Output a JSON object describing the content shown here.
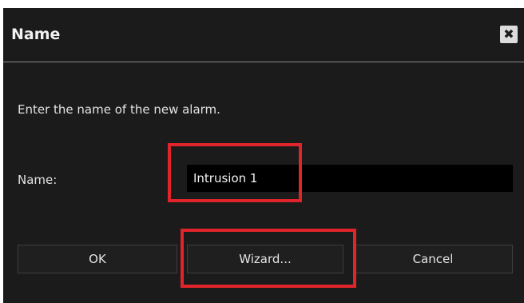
{
  "dialog": {
    "title": "Name",
    "close_symbol": "✖",
    "close_icon": "close-icon",
    "instruction": "Enter the name of the new alarm.",
    "name_label": "Name:",
    "name_value": "Intrusion 1"
  },
  "buttons": {
    "ok_label": "OK",
    "wizard_label": "Wizard...",
    "cancel_label": "Cancel"
  },
  "colors": {
    "dialog_background": "#1b1b1b",
    "input_background": "#000000",
    "highlight": "#e0242b"
  }
}
